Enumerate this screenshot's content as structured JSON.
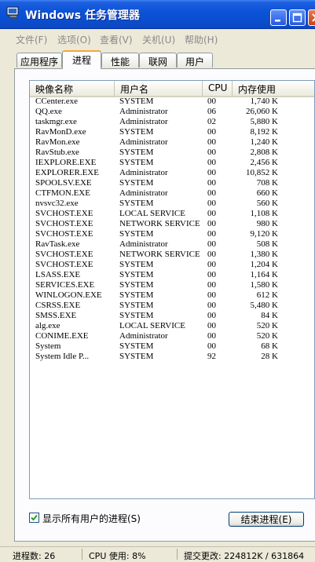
{
  "window": {
    "title": "Windows 任务管理器",
    "colors": {
      "titlebar": "#0b53d8",
      "tab_active_accent": "#f9a438"
    }
  },
  "menu": [
    {
      "label": "文件(F)"
    },
    {
      "label": "选项(O)"
    },
    {
      "label": "查看(V)"
    },
    {
      "label": "关机(U)"
    },
    {
      "label": "帮助(H)"
    }
  ],
  "tabs": [
    {
      "label": "应用程序"
    },
    {
      "label": "进程",
      "active": true
    },
    {
      "label": "性能"
    },
    {
      "label": "联网"
    },
    {
      "label": "用户"
    }
  ],
  "columns": {
    "name": "映像名称",
    "user": "用户名",
    "cpu": "CPU",
    "mem": "内存使用"
  },
  "processes": [
    {
      "name": "CCenter.exe",
      "user": "SYSTEM",
      "cpu": "00",
      "mem": "1,740 K"
    },
    {
      "name": "QQ.exe",
      "user": "Administrator",
      "cpu": "06",
      "mem": "26,060 K"
    },
    {
      "name": "taskmgr.exe",
      "user": "Administrator",
      "cpu": "02",
      "mem": "5,880 K"
    },
    {
      "name": "RavMonD.exe",
      "user": "SYSTEM",
      "cpu": "00",
      "mem": "8,192 K"
    },
    {
      "name": "RavMon.exe",
      "user": "Administrator",
      "cpu": "00",
      "mem": "1,240 K"
    },
    {
      "name": "RavStub.exe",
      "user": "SYSTEM",
      "cpu": "00",
      "mem": "2,808 K"
    },
    {
      "name": "IEXPLORE.EXE",
      "user": "SYSTEM",
      "cpu": "00",
      "mem": "2,456 K"
    },
    {
      "name": "EXPLORER.EXE",
      "user": "Administrator",
      "cpu": "00",
      "mem": "10,852 K"
    },
    {
      "name": "SPOOLSV.EXE",
      "user": "SYSTEM",
      "cpu": "00",
      "mem": "708 K"
    },
    {
      "name": "CTFMON.EXE",
      "user": "Administrator",
      "cpu": "00",
      "mem": "660 K"
    },
    {
      "name": "nvsvc32.exe",
      "user": "SYSTEM",
      "cpu": "00",
      "mem": "560 K"
    },
    {
      "name": "SVCHOST.EXE",
      "user": "LOCAL SERVICE",
      "cpu": "00",
      "mem": "1,108 K"
    },
    {
      "name": "SVCHOST.EXE",
      "user": "NETWORK SERVICE",
      "cpu": "00",
      "mem": "980 K"
    },
    {
      "name": "SVCHOST.EXE",
      "user": "SYSTEM",
      "cpu": "00",
      "mem": "9,120 K"
    },
    {
      "name": "RavTask.exe",
      "user": "Administrator",
      "cpu": "00",
      "mem": "508 K"
    },
    {
      "name": "SVCHOST.EXE",
      "user": "NETWORK SERVICE",
      "cpu": "00",
      "mem": "1,380 K"
    },
    {
      "name": "SVCHOST.EXE",
      "user": "SYSTEM",
      "cpu": "00",
      "mem": "1,204 K"
    },
    {
      "name": "LSASS.EXE",
      "user": "SYSTEM",
      "cpu": "00",
      "mem": "1,164 K"
    },
    {
      "name": "SERVICES.EXE",
      "user": "SYSTEM",
      "cpu": "00",
      "mem": "1,580 K"
    },
    {
      "name": "WINLOGON.EXE",
      "user": "SYSTEM",
      "cpu": "00",
      "mem": "612 K"
    },
    {
      "name": "CSRSS.EXE",
      "user": "SYSTEM",
      "cpu": "00",
      "mem": "5,480 K"
    },
    {
      "name": "SMSS.EXE",
      "user": "SYSTEM",
      "cpu": "00",
      "mem": "84 K"
    },
    {
      "name": "alg.exe",
      "user": "LOCAL SERVICE",
      "cpu": "00",
      "mem": "520 K"
    },
    {
      "name": "CONIME.EXE",
      "user": "Administrator",
      "cpu": "00",
      "mem": "520 K"
    },
    {
      "name": "System",
      "user": "SYSTEM",
      "cpu": "00",
      "mem": "68 K"
    },
    {
      "name": "System Idle P...",
      "user": "SYSTEM",
      "cpu": "92",
      "mem": "28 K"
    }
  ],
  "show_all": {
    "label": "显示所有用户的进程(S)",
    "checked": true
  },
  "end_process": {
    "label": "结束进程(E)"
  },
  "status": {
    "processes": "进程数: 26",
    "cpu": "CPU 使用: 8%",
    "commit": "提交更改: 224812K / 631864"
  }
}
